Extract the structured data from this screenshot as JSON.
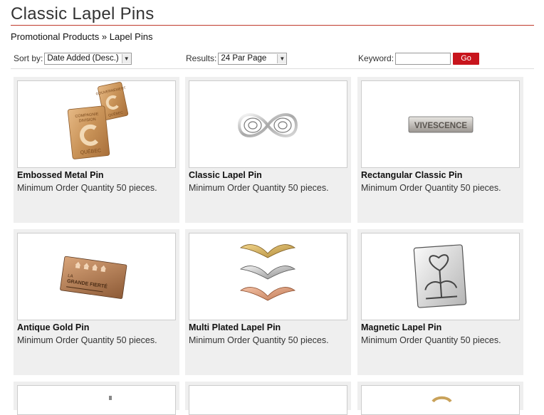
{
  "page": {
    "title": "Classic Lapel Pins"
  },
  "breadcrumb": {
    "parent": "Promotional Products",
    "separator": "»",
    "current": "Lapel Pins"
  },
  "toolbar": {
    "sort_label": "Sort by:",
    "sort_value": "Date Added (Desc.)",
    "results_label": "Results:",
    "results_value": "24 Par Page",
    "keyword_label": "Keyword:",
    "keyword_value": "",
    "go_label": "Go"
  },
  "products": [
    {
      "name": "Embossed Metal Pin",
      "desc": "Minimum Order Quantity 50 pieces.",
      "image_icon": "embossed-pin-image"
    },
    {
      "name": "Classic Lapel Pin",
      "desc": "Minimum Order Quantity 50 pieces.",
      "image_icon": "infinity-pin-image"
    },
    {
      "name": "Rectangular Classic Pin",
      "desc": "Minimum Order Quantity 50 pieces.",
      "image_icon": "rectangular-pin-image"
    },
    {
      "name": "Antique Gold Pin",
      "desc": "Minimum Order Quantity 50 pieces.",
      "image_icon": "antique-gold-pin-image"
    },
    {
      "name": "Multi Plated Lapel Pin",
      "desc": "Minimum Order Quantity 50 pieces.",
      "image_icon": "wings-pin-image"
    },
    {
      "name": "Magnetic Lapel Pin",
      "desc": "Minimum Order Quantity 50 pieces.",
      "image_icon": "heart-flower-pin-image"
    }
  ],
  "image_text": {
    "embossed_pin": "QUÉBEC",
    "rect_pin": "VIVESCENCE",
    "antique_pin_line1": "LA",
    "antique_pin_line2": "GRANDE FIERTÉ"
  }
}
